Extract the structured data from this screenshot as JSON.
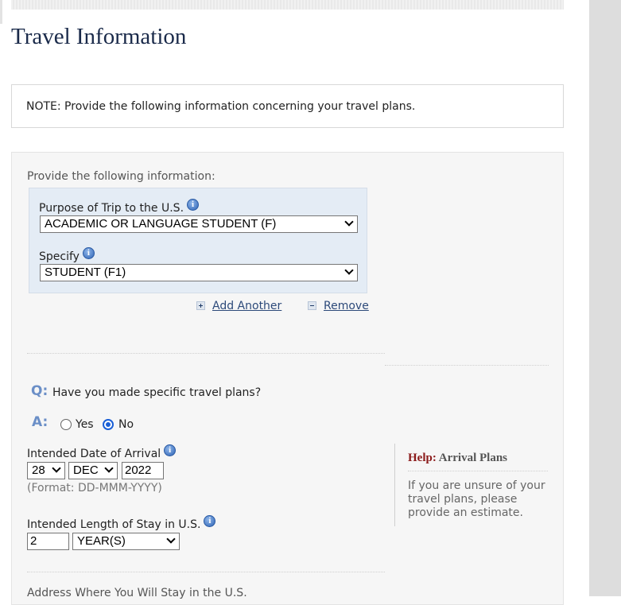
{
  "page": {
    "title": "Travel Information"
  },
  "note": {
    "text": "NOTE: Provide the following information concerning your travel plans."
  },
  "form": {
    "provide_label": "Provide the following information:",
    "purpose": {
      "label": "Purpose of Trip to the U.S.",
      "value": "ACADEMIC OR LANGUAGE STUDENT (F)"
    },
    "specify": {
      "label": "Specify",
      "value": "STUDENT (F1)"
    },
    "add_another": "Add Another",
    "remove": "Remove",
    "question": {
      "q_letter": "Q:",
      "text": "Have you made specific travel plans?",
      "a_letter": "A:",
      "options": [
        "Yes",
        "No"
      ],
      "selected": "No"
    },
    "arrival": {
      "label": "Intended Date of Arrival",
      "day": "28",
      "month": "DEC",
      "year": "2022",
      "format_hint": "(Format: DD-MMM-YYYY)"
    },
    "stay": {
      "label": "Intended Length of Stay in U.S.",
      "value": "2",
      "unit": "YEAR(S)"
    },
    "address_label": "Address Where You Will Stay in the U.S."
  },
  "help": {
    "prefix": "Help:",
    "title": "Arrival Plans",
    "text": "If you are unsure of your travel plans, please provide an estimate."
  },
  "colors": {
    "title": "#1a2a4a",
    "panel_bg": "#f6f6f6",
    "purpose_bg": "#e4ecf5",
    "link": "#2d4a7a",
    "help_prefix": "#8b1a1a",
    "qa_letter": "#6b8fc7",
    "radio_selected": "#1a5fd6"
  }
}
